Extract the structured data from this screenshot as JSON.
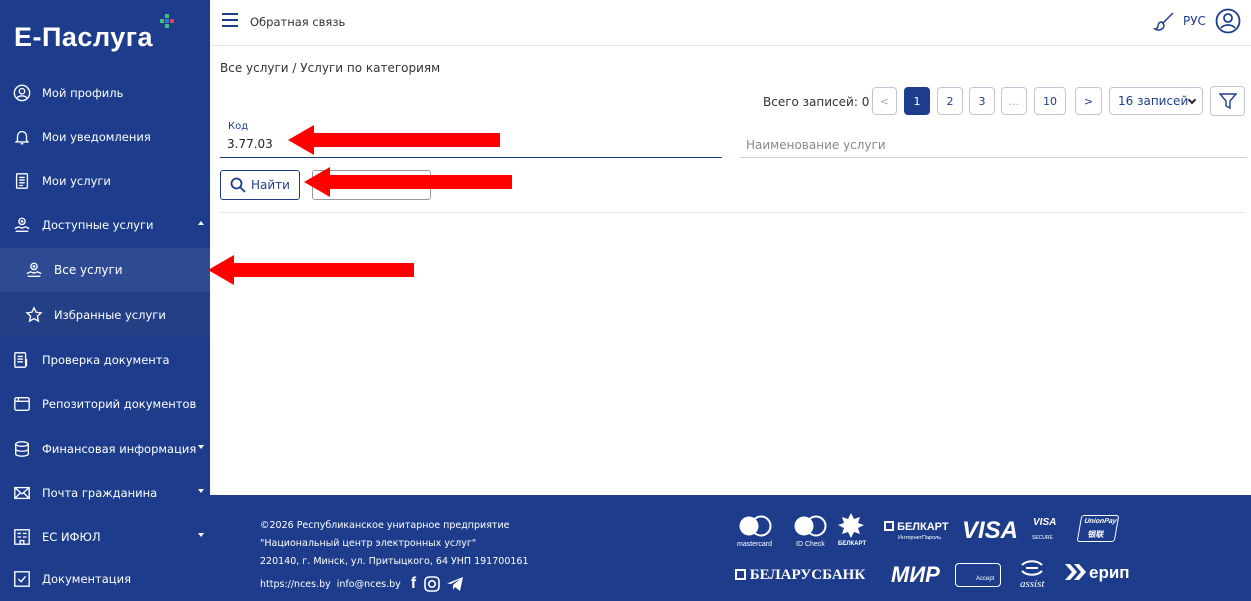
{
  "brand": {
    "name": "Е-Паслуга"
  },
  "sidebar": {
    "items": [
      {
        "key": "profile",
        "label": "Мой профиль",
        "icon": "user-circle-icon"
      },
      {
        "key": "notifications",
        "label": "Мои уведомления",
        "icon": "bell-icon"
      },
      {
        "key": "my-services",
        "label": "Мои услуги",
        "icon": "document-list-icon"
      },
      {
        "key": "available",
        "label": "Доступные услуги",
        "icon": "services-icon",
        "expanded": true
      },
      {
        "key": "all",
        "label": "Все услуги",
        "icon": "services-icon",
        "active": true
      },
      {
        "key": "favorites",
        "label": "Избранные услуги",
        "icon": "star-icon"
      },
      {
        "key": "doc-check",
        "label": "Проверка документа",
        "icon": "document-check-icon"
      },
      {
        "key": "repo",
        "label": "Репозиторий документов",
        "icon": "folder-icon"
      },
      {
        "key": "finance",
        "label": "Финансовая информация",
        "icon": "database-icon"
      },
      {
        "key": "mail",
        "label": "Почта гражданина",
        "icon": "envelope-icon"
      },
      {
        "key": "esifol",
        "label": "ЕС ИФЮЛ",
        "icon": "building-icon"
      },
      {
        "key": "docs",
        "label": "Документация",
        "icon": "checkbox-icon"
      }
    ]
  },
  "topbar": {
    "feedback": "Обратная связь",
    "language": "РУС"
  },
  "breadcrumb": "Все услуги / Услуги по категориям",
  "pagination": {
    "total_label": "Всего записей:",
    "total_value": "0",
    "prev": "<",
    "pages": [
      "1",
      "2",
      "3",
      "...",
      "10"
    ],
    "current": "1",
    "next": ">",
    "per_page": "16 записей"
  },
  "filters": {
    "code_label": "Код",
    "code_value": "3.77.03",
    "name_placeholder": "Наименование услуги",
    "find_label": "Найти"
  },
  "footer": {
    "copyright": "©2026 Республиканское унитарное предприятие",
    "org": "\"Национальный центр электронных услуг\"",
    "address": "220140, г. Минск, ул. Притыцкого, 64  УНП 191700161",
    "site": "https://nces.by",
    "email": "info@nces.by",
    "payments": {
      "belkart": "БЕЛКАРТ",
      "belkart_sub": "ИнтернетПароль",
      "visa": "VISA",
      "visa_secure": "VISA",
      "secure": "SECURE",
      "mastercard": "mastercard",
      "idcheck": "ID Check",
      "belkart_small": "БЕЛКАРТ",
      "unionpay": "UnionPay",
      "unionpay_cn": "银联",
      "belarusbank": "БЕЛАРУСБАНК",
      "mir": "МИР",
      "mir_accept": "Accept",
      "assist": "assist",
      "erip": "ерип"
    }
  },
  "colors": {
    "primary": "#1d3d8c",
    "annotation": "#ff0000"
  }
}
